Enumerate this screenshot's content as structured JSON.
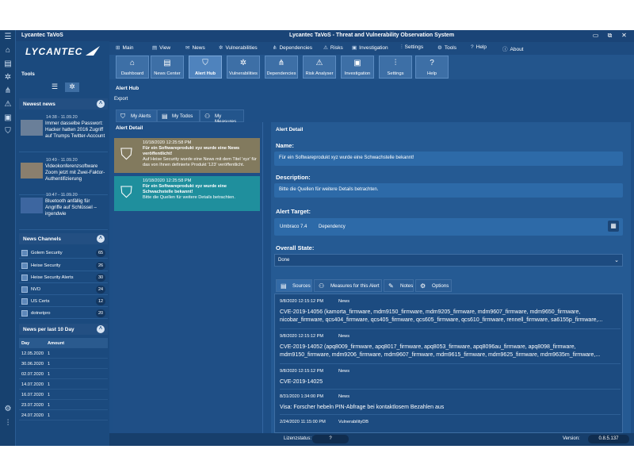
{
  "app": {
    "short_title": "Lycantec TaVoS",
    "title": "Lycantec TaVoS - Threat and Vulnerability Observation System",
    "logo_text": "LYCANTEC"
  },
  "window": {
    "minimize": "▭",
    "restore": "⧉",
    "close": "✕"
  },
  "sidebar": {
    "tools_label": "Tools",
    "newest_news_label": "Newest news",
    "news": [
      {
        "date": "14:38 - 11.09.20",
        "text": "Immer dasselbe Passwort: Hacker hatten 2016 Zugriff auf Trumps Twitter-Account"
      },
      {
        "date": "10:49 - 11.09.20",
        "text": "Videokonferenzsoftware Zoom jetzt mit Zwei-Faktor-Authentifizierung"
      },
      {
        "date": "10:47 - 11.09.20",
        "text": "Bluetooth anfällig für Angriffe auf Schlüssel – irgendwie"
      }
    ],
    "news_channels_label": "News Channels",
    "channels": [
      {
        "name": "Golem Security",
        "count": "65"
      },
      {
        "name": "Heise Security",
        "count": "26"
      },
      {
        "name": "Heise Security Alerts",
        "count": "30"
      },
      {
        "name": "NVD",
        "count": "24"
      },
      {
        "name": "US Certs",
        "count": "12"
      },
      {
        "name": "dotnetpro",
        "count": "20"
      }
    ],
    "news_per_day_label": "News per last 10 Day",
    "day_header": {
      "day": "Day",
      "amount": "Amount"
    },
    "days": [
      {
        "day": "12.05.2020",
        "amount": "1"
      },
      {
        "day": "30.06.2020",
        "amount": "1"
      },
      {
        "day": "02.07.2020",
        "amount": "1"
      },
      {
        "day": "14.07.2020",
        "amount": "1"
      },
      {
        "day": "16.07.2020",
        "amount": "1"
      },
      {
        "day": "23.07.2020",
        "amount": "1"
      },
      {
        "day": "24.07.2020",
        "amount": "1"
      }
    ]
  },
  "menu": [
    "Main",
    "View",
    "News",
    "Vulnerabilities",
    "Dependencies",
    "Risks",
    "Investigation",
    "Settings",
    "Tools",
    "Help",
    "About"
  ],
  "ribbon": [
    "Dashboard",
    "News Center",
    "Alert Hub",
    "Vulnerabilities",
    "Dependencies",
    "Risk Analyser",
    "Investigation",
    "Settings",
    "Help"
  ],
  "hub": {
    "title": "Alert Hub",
    "export_label": "Export"
  },
  "tabs": [
    "My Alerts",
    "My Todos",
    "My Measures"
  ],
  "alerts": {
    "head": "Alert Detail",
    "items": [
      {
        "date": "10/18/2020 12:25:58 PM",
        "title": "Für ein Softwareprodukt xyz wurde eine News veröffentlicht!",
        "body": "Auf Heise Security wurde eine News mit dem Titel 'xyz' für das von Ihnen definierte Produkt '123' veröffentlicht.",
        "color": "#827a5e"
      },
      {
        "date": "10/18/2020 12:25:58 PM",
        "title": "Für ein Softwareprodukt xyz wurde eine Schwachstelle bekannt!",
        "body": "Bitte die Quellen für weitere Details betrachten.",
        "color": "#1f8f9d"
      }
    ]
  },
  "detail": {
    "head": "Alert Detail",
    "name_label": "Name:",
    "name_value": "Für ein Softwareprodukt xyz wurde eine Schwachstelle bekannt!",
    "description_label": "Description:",
    "description_value": "Bitte die Quellen für weitere Details betrachten.",
    "target_label": "Alert Target:",
    "target_product": "Umbraco 7.4",
    "target_type": "Dependency",
    "state_label": "Overall State:",
    "state_value": "Done"
  },
  "subtabs": [
    "Sources",
    "Measures for this Alert",
    "Notes",
    "Options"
  ],
  "sources": [
    {
      "date": "9/8/2020 12:15:12 PM",
      "type": "News",
      "text": "CVE-2019-14056 (kamorta_firmware, mdm9150_firmware, mdm9205_firmware, mdm9607_firmware, mdm9650_firmware,\nnicobar_firmware, qcs404_firmware, qcs405_firmware, qcs605_firmware, qcs610_firmware, rennell_firmware, sa6155p_firmware,..."
    },
    {
      "date": "9/8/2020 12:15:12 PM",
      "type": "News",
      "text": "CVE-2019-14052 (apq8009_firmware, apq8017_firmware, apq8053_firmware, apq8096au_firmware, apq8098_firmware,\nmdm9150_firmware, mdm9206_firmware, mdm9607_firmware, mdm9615_firmware, mdm9625_firmware, mdm9635m_firmware,..."
    },
    {
      "date": "9/8/2020 12:15:12 PM",
      "type": "News",
      "text": "CVE-2019-14025"
    },
    {
      "date": "8/31/2020 1:34:00 PM",
      "type": "News",
      "text": "Visa: Forscher hebeln PIN-Abfrage bei kontaktlosem Bezahlen aus"
    },
    {
      "date": "2/24/2020 11:15:00 PM",
      "type": "VulnerabilityDB",
      "text": ""
    }
  ],
  "status": {
    "license_label": "Lizenzstatus:",
    "license_value": "?",
    "version_label": "Version:",
    "version_value": "0.8.5.137"
  }
}
